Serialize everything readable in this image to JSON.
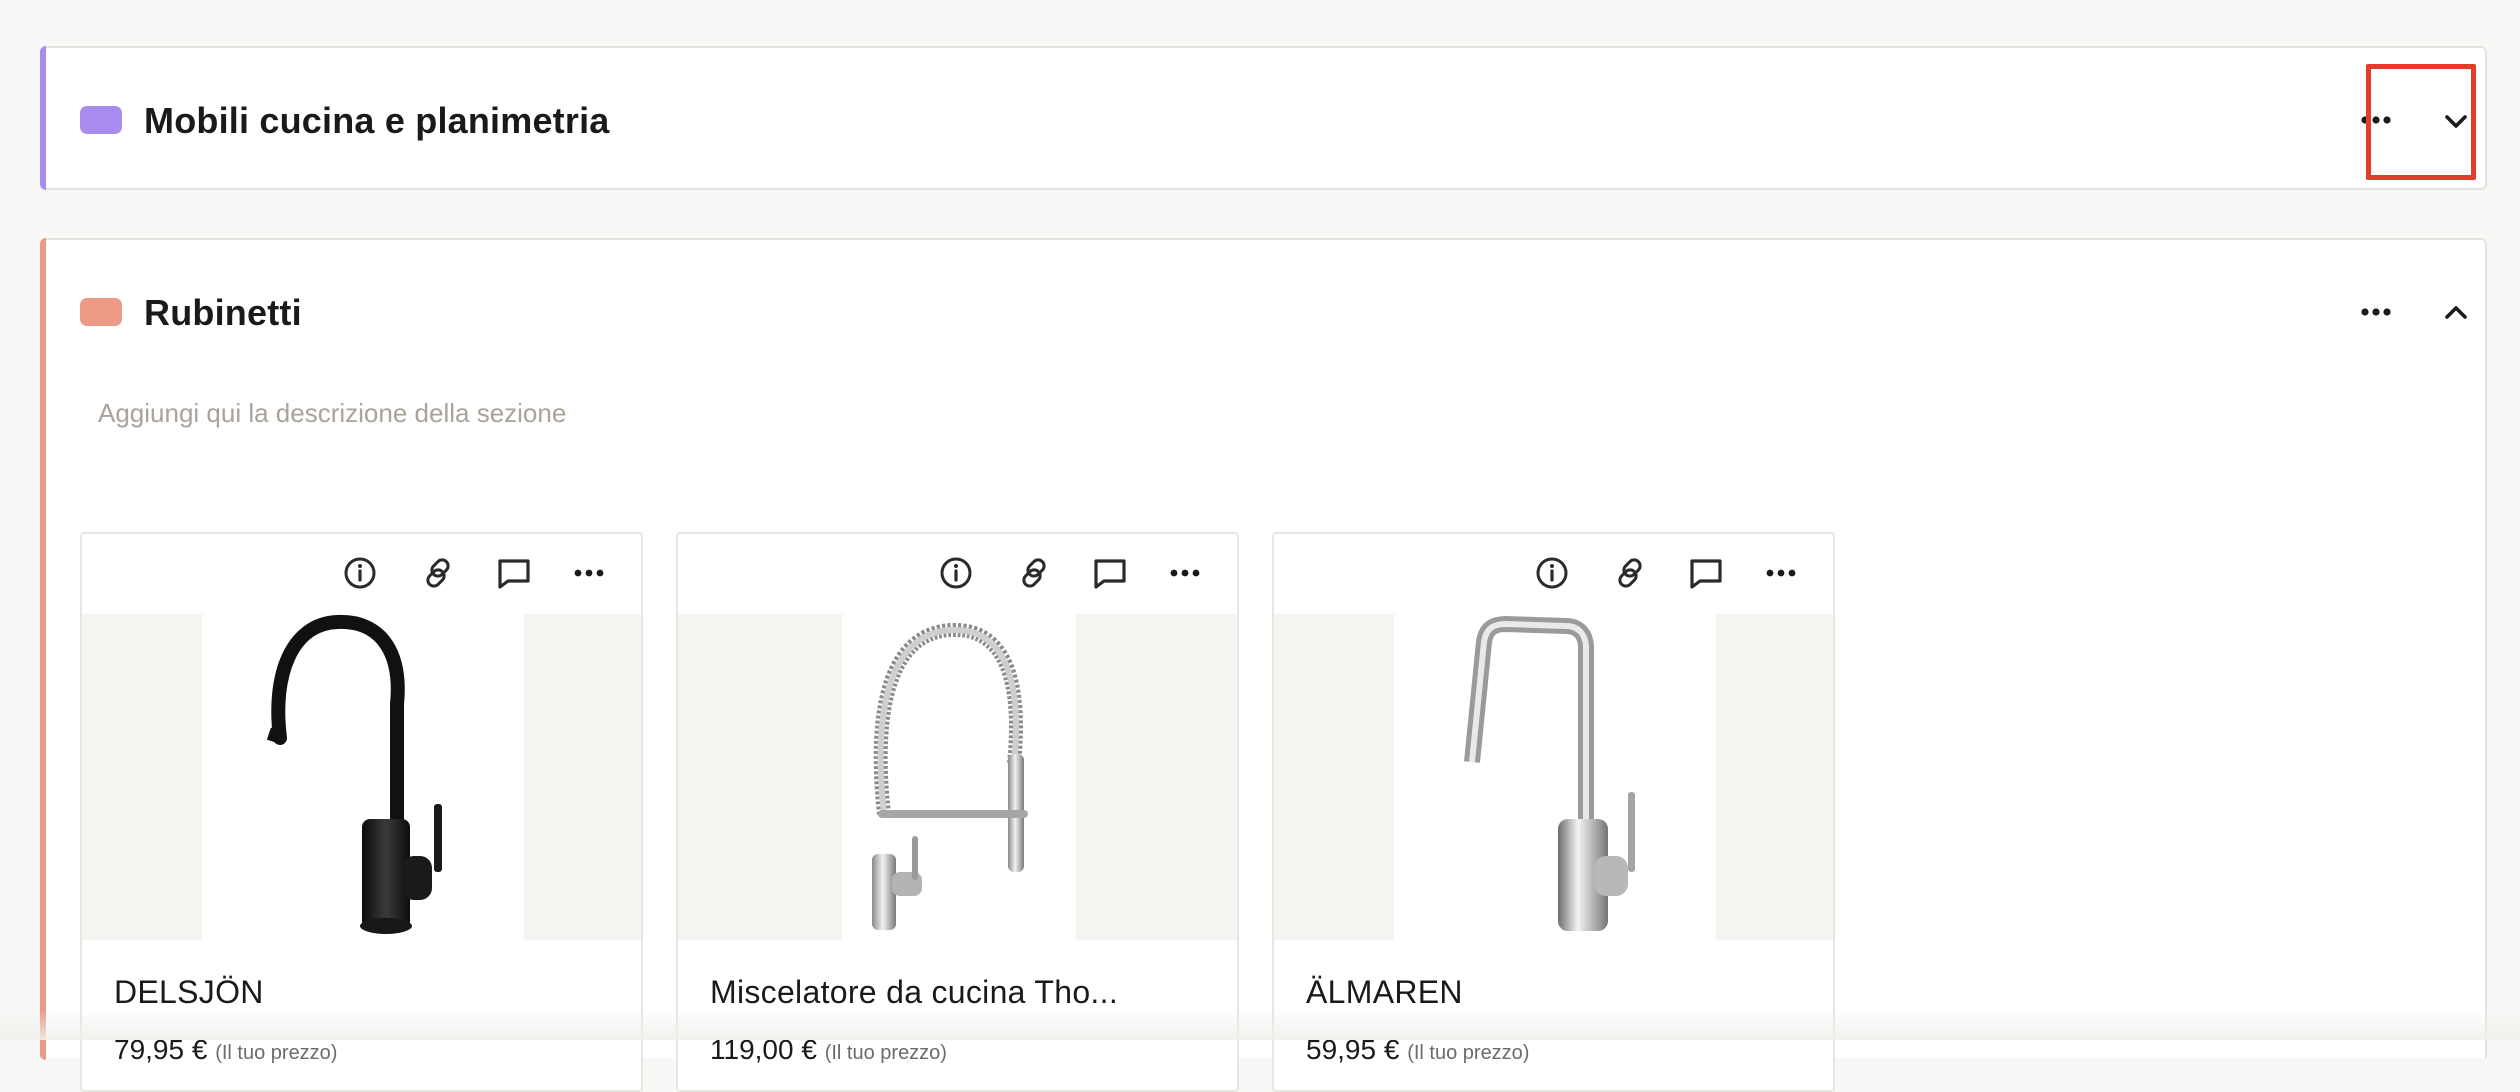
{
  "sections": [
    {
      "title": "Mobili cucina e planimetria",
      "color": "#a98cf0",
      "more_icon": "ellipsis-icon",
      "toggle_icon": "chevron-down-icon"
    },
    {
      "title": "Rubinetti",
      "color": "#ec9a86",
      "more_icon": "ellipsis-icon",
      "toggle_icon": "chevron-up-icon",
      "description_placeholder": "Aggiungi qui la descrizione della sezione",
      "products": [
        {
          "name": "DELSJÖN",
          "price": "79,95 €",
          "price_note": "(Il tuo prezzo)"
        },
        {
          "name": "Miscelatore da cucina Tho...",
          "price": "119,00 €",
          "price_note": "(Il tuo prezzo)"
        },
        {
          "name": "ÄLMAREN",
          "price": "59,95 €",
          "price_note": "(Il tuo prezzo)"
        }
      ],
      "card_tools": [
        "info-icon",
        "link-icon",
        "comment-icon",
        "ellipsis-icon"
      ]
    }
  ],
  "highlight_color": "#e03d2b"
}
